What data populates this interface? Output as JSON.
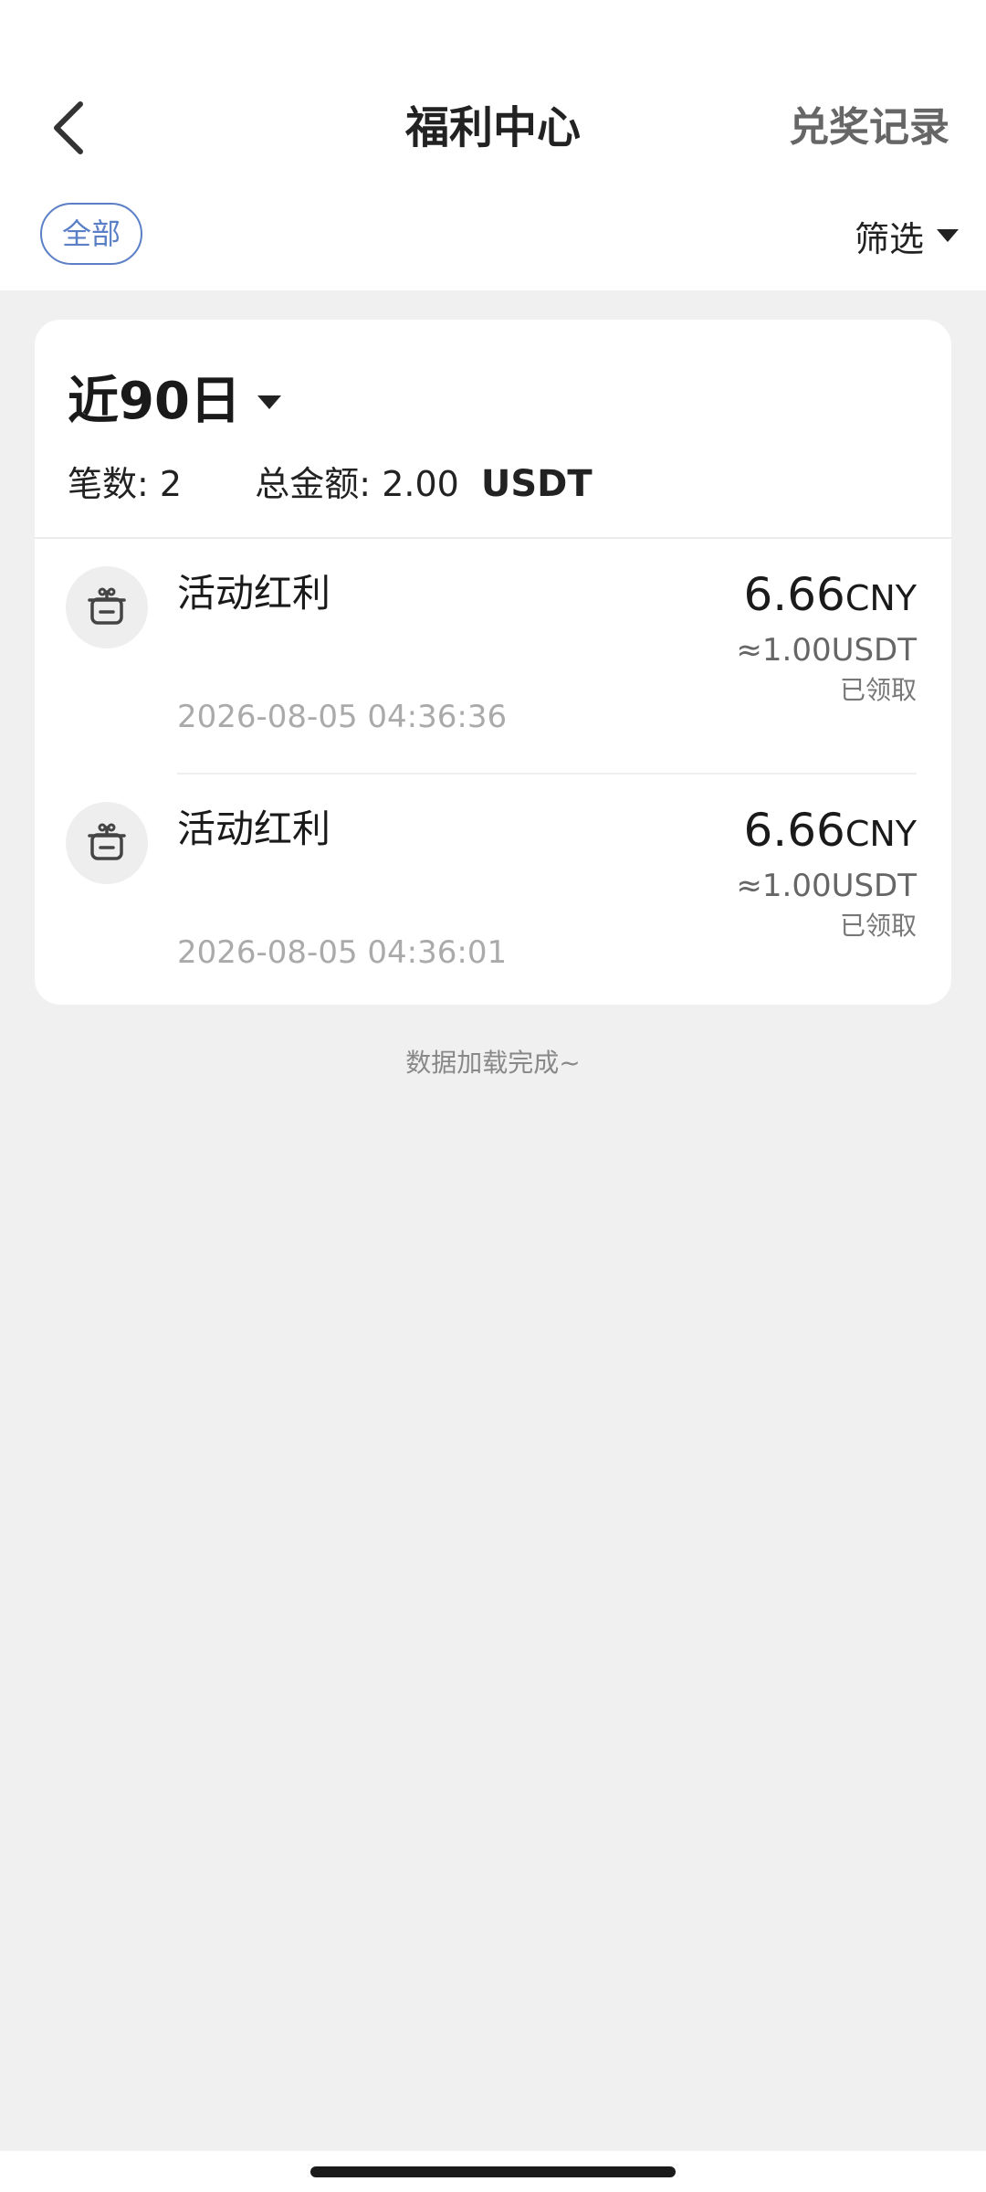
{
  "header": {
    "title": "福利中心",
    "records_link": "兑奖记录"
  },
  "filter": {
    "all_label": "全部",
    "filter_label": "筛选"
  },
  "summary": {
    "period_label": "近90日",
    "count_label": "笔数:",
    "count_value": "2",
    "total_label": "总金额:",
    "total_value": "2.00",
    "total_unit": "USDT"
  },
  "records": [
    {
      "title": "活动红利",
      "time": "2026-08-05 04:36:36",
      "amount": "6.66",
      "currency": "CNY",
      "approx": "≈1.00USDT",
      "status": "已领取",
      "icon": "gift-box-icon"
    },
    {
      "title": "活动红利",
      "time": "2026-08-05 04:36:01",
      "amount": "6.66",
      "currency": "CNY",
      "approx": "≈1.00USDT",
      "status": "已领取",
      "icon": "gift-box-icon"
    }
  ],
  "footer": {
    "end_text": "数据加载完成~"
  },
  "colors": {
    "accent": "#5b7fc7",
    "background": "#f0f0f0",
    "card": "#ffffff"
  }
}
